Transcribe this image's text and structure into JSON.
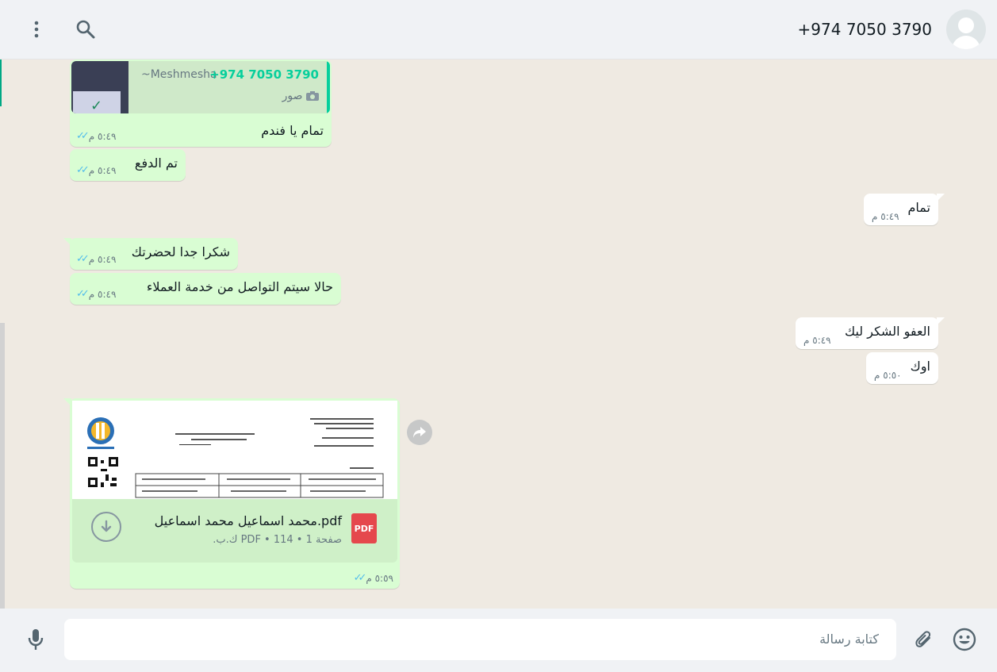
{
  "header": {
    "contact": "+974 7050 3790"
  },
  "messages": {
    "m1": {
      "quoted_sender": "+974 7050 3790",
      "quoted_name": "~Meshmesha",
      "quoted_type": "صور",
      "text": "تمام يا فندم",
      "time": "٥:٤٩ م"
    },
    "m2": {
      "text": "تم الدفع",
      "time": "٥:٤٩ م"
    },
    "m3": {
      "text": "تمام",
      "time": "٥:٤٩ م"
    },
    "m4": {
      "text": "شكرا جدا لحضرتك",
      "time": "٥:٤٩ م"
    },
    "m5": {
      "text": "حالا سيتم التواصل من خدمة العملاء",
      "time": "٥:٤٩ م"
    },
    "m6": {
      "text": "العفو الشكر ليك",
      "time": "٥:٤٩ م"
    },
    "m7": {
      "text": "اوك",
      "time": "٥:٥٠ م"
    },
    "doc": {
      "filename": "محمد اسماعيل محمد اسماعيل.pdf",
      "info": "صفحة 1 • PDF • 114 ك.ب.",
      "badge": "PDF",
      "time": "٥:٥٩ م"
    }
  },
  "footer": {
    "placeholder": "كتابة رسالة"
  },
  "colors": {
    "accent": "#00a884",
    "outgoing": "#d9fdd3",
    "incoming": "#ffffff",
    "read_check": "#53bdeb"
  }
}
